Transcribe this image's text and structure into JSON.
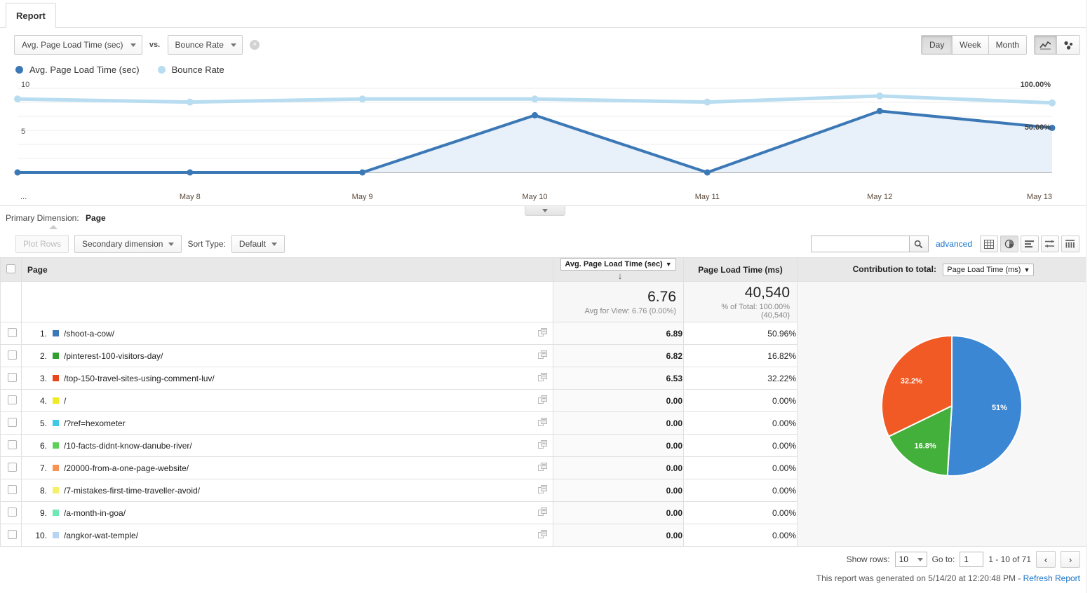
{
  "tab": {
    "label": "Report"
  },
  "metric_bar": {
    "primary_metric": "Avg. Page Load Time (sec)",
    "vs_label": "vs.",
    "secondary_metric": "Bounce Rate",
    "clear_label": "×",
    "granularity": {
      "options": [
        "Day",
        "Week",
        "Month"
      ],
      "selected": "Day"
    },
    "view_icons": [
      {
        "name": "line-chart-icon",
        "selected": true
      },
      {
        "name": "motion-chart-icon",
        "selected": false
      }
    ]
  },
  "legend": [
    {
      "label": "Avg. Page Load Time (sec)",
      "color": "#3b78b6"
    },
    {
      "label": "Bounce Rate",
      "color": "#b8dcf0"
    }
  ],
  "chart_data": {
    "type": "line",
    "title": "",
    "xlabel": "",
    "ylabel": "",
    "x": [
      "...",
      "May 8",
      "May 9",
      "May 10",
      "May 11",
      "May 12",
      "May 13"
    ],
    "tick_labels_visible": [
      "...",
      "May 8",
      "May 9",
      "May 10",
      "May 11",
      "May 12",
      "May 13"
    ],
    "left_axis": {
      "ticks": [
        "10",
        "5"
      ],
      "ylim": [
        0,
        10
      ],
      "label": ""
    },
    "right_axis": {
      "ticks": [
        "100.00%",
        "50.00%"
      ],
      "ylim": [
        0,
        110
      ],
      "label": ""
    },
    "grid": true,
    "legend_position": "top-left",
    "series": [
      {
        "name": "Avg. Page Load Time (sec)",
        "color": "#3b78b6",
        "axis": "left",
        "filled": true,
        "values": [
          0,
          0,
          0,
          6.8,
          0,
          7.3,
          5.3
        ]
      },
      {
        "name": "Bounce Rate",
        "color": "#b8dcf0",
        "axis": "right",
        "filled": false,
        "values": [
          96,
          92,
          96,
          96,
          92,
          100,
          91
        ]
      }
    ]
  },
  "primary_dimension": {
    "label": "Primary Dimension:",
    "value": "Page"
  },
  "table_toolbar": {
    "plot_rows": "Plot Rows",
    "secondary_dimension": "Secondary dimension",
    "sort_type_label": "Sort Type:",
    "sort_type_value": "Default",
    "search_value": "",
    "search_placeholder": "",
    "advanced": "advanced",
    "view_icons": [
      {
        "name": "table-view-icon",
        "selected": false
      },
      {
        "name": "pie-view-icon",
        "selected": true
      },
      {
        "name": "bar-view-icon",
        "selected": false
      },
      {
        "name": "comparison-view-icon",
        "selected": false
      },
      {
        "name": "pivot-view-icon",
        "selected": false
      }
    ]
  },
  "table": {
    "headers": {
      "page": "Page",
      "metric_select": "Avg. Page Load Time (sec)",
      "page_load_ms": "Page Load Time (ms)",
      "contribution_label": "Contribution to total:",
      "contribution_select": "Page Load Time (ms)"
    },
    "summary": {
      "avg_value": "6.76",
      "avg_sub": "Avg for View: 6.76 (0.00%)",
      "total_value": "40,540",
      "total_sub": "% of Total: 100.00% (40,540)"
    },
    "rows": [
      {
        "rank": "1.",
        "color": "#3b78b6",
        "page": "/shoot-a-cow/",
        "avg": "6.89",
        "pct": "50.96%"
      },
      {
        "rank": "2.",
        "color": "#32a031",
        "page": "/pinterest-100-visitors-day/",
        "avg": "6.82",
        "pct": "16.82%"
      },
      {
        "rank": "3.",
        "color": "#e8471c",
        "page": "/top-150-travel-sites-using-comment-luv/",
        "avg": "6.53",
        "pct": "32.22%"
      },
      {
        "rank": "4.",
        "color": "#eeea23",
        "page": "/",
        "avg": "0.00",
        "pct": "0.00%"
      },
      {
        "rank": "5.",
        "color": "#3fc8e8",
        "page": "/?ref=hexometer",
        "avg": "0.00",
        "pct": "0.00%"
      },
      {
        "rank": "6.",
        "color": "#5ed05a",
        "page": "/10-facts-didnt-know-danube-river/",
        "avg": "0.00",
        "pct": "0.00%"
      },
      {
        "rank": "7.",
        "color": "#f79253",
        "page": "/20000-from-a-one-page-website/",
        "avg": "0.00",
        "pct": "0.00%"
      },
      {
        "rank": "8.",
        "color": "#f5f06a",
        "page": "/7-mistakes-first-time-traveller-avoid/",
        "avg": "0.00",
        "pct": "0.00%"
      },
      {
        "rank": "9.",
        "color": "#6fe8b4",
        "page": "/a-month-in-goa/",
        "avg": "0.00",
        "pct": "0.00%"
      },
      {
        "rank": "10.",
        "color": "#b8d4f5",
        "page": "/angkor-wat-temple/",
        "avg": "0.00",
        "pct": "0.00%"
      }
    ]
  },
  "pie_chart": {
    "type": "pie",
    "title": "",
    "slices": [
      {
        "label": "/shoot-a-cow/",
        "value": 51.0,
        "display": "51%",
        "color": "#3b87d4"
      },
      {
        "label": "/pinterest-100-visitors-day/",
        "value": 16.8,
        "display": "16.8%",
        "color": "#44b03c"
      },
      {
        "label": "/top-150-travel-sites-using-comment-luv/",
        "value": 32.2,
        "display": "32.2%",
        "color": "#f15a24"
      }
    ]
  },
  "footer": {
    "show_rows_label": "Show rows:",
    "show_rows_value": "10",
    "goto_label": "Go to:",
    "goto_value": "1",
    "range_label": "1 - 10 of 71",
    "prev_icon": "‹",
    "next_icon": "›",
    "generated_text": "This report was generated on 5/14/20 at 12:20:48 PM - ",
    "refresh_label": "Refresh Report"
  }
}
